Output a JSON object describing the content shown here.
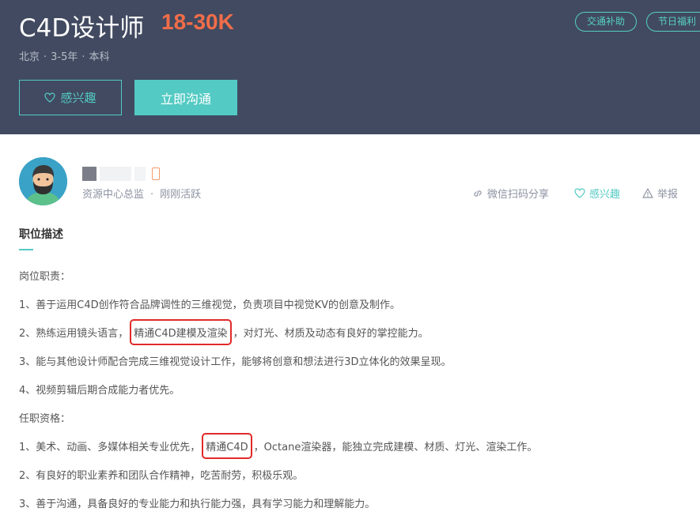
{
  "header": {
    "job_title": "C4D设计师",
    "salary": "18-30K",
    "meta": {
      "city": "北京",
      "experience": "3-5年",
      "education": "本科",
      "sep": "·"
    },
    "tags": [
      "交通补助",
      "节日福利"
    ],
    "interest_button": "感兴趣",
    "chat_button": "立即沟通"
  },
  "poster": {
    "title": "资源中心总监",
    "status": "刚刚活跃",
    "sep": "·"
  },
  "actions": {
    "share": "微信扫码分享",
    "interest": "感兴趣",
    "report": "举报"
  },
  "colors": {
    "header_bg": "#414a60",
    "accent": "#53cac3",
    "salary": "#f26d49",
    "highlight_box": "#e02a2a"
  },
  "section": {
    "title": "职位描述",
    "lines": [
      {
        "text": "岗位职责："
      },
      {
        "text": "1、善于运用C4D创作符合品牌调性的三维视觉，负责项目中视觉KV的创意及制作。"
      },
      {
        "pre": "2、熟练运用镜头语言，",
        "hl": "精通C4D建模及渲染",
        "post": "，对灯光、材质及动态有良好的掌控能力。"
      },
      {
        "text": "3、能与其他设计师配合完成三维视觉设计工作，能够将创意和想法进行3D立体化的效果呈现。"
      },
      {
        "text": "4、视频剪辑后期合成能力者优先。"
      },
      {
        "text": "任职资格："
      },
      {
        "pre": "1、美术、动画、多媒体相关专业优先，",
        "hl": "精通C4D",
        "post": "，Octane渲染器，能独立完成建模、材质、灯光、渲染工作。"
      },
      {
        "text": "2、有良好的职业素养和团队合作精神，吃苦耐劳，积极乐观。"
      },
      {
        "text": "3、善于沟通，具备良好的专业能力和执行能力强，具有学习能力和理解能力。"
      }
    ]
  }
}
